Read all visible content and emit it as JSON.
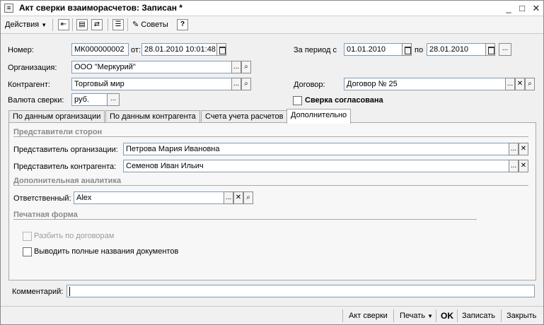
{
  "window": {
    "title": "Акт сверки взаиморасчетов: Записан *",
    "minimize_glyph": "_",
    "maximize_glyph": "□",
    "close_glyph": "✕"
  },
  "toolbar": {
    "actions_label": "Действия",
    "advice_label": "Советы",
    "help_glyph": "?"
  },
  "header": {
    "number_label": "Номер:",
    "number_value": "МК000000002",
    "from_label": "от:",
    "date_value": "28.01.2010 10:01:48",
    "period_label": "За период с",
    "period_from": "01.01.2010",
    "period_to_label": "по",
    "period_to": "28.01.2010",
    "organization_label": "Организация:",
    "organization_value": "ООО \"Меркурий\"",
    "counterparty_label": "Контрагент:",
    "counterparty_value": "Торговый мир",
    "contract_label": "Договор:",
    "contract_value": "Договор № 25",
    "currency_label": "Валюта сверки:",
    "currency_value": "руб.",
    "agreed_label": "Сверка согласована"
  },
  "tabs": [
    {
      "label": "По данным организации"
    },
    {
      "label": "По данным контрагента"
    },
    {
      "label": "Счета учета расчетов"
    },
    {
      "label": "Дополнительно"
    }
  ],
  "panel": {
    "reps_title": "Представители сторон",
    "org_rep_label": "Представитель организации:",
    "org_rep_value": "Петрова  Мария Ивановна",
    "cp_rep_label": "Представитель контрагента:",
    "cp_rep_value": "Семенов Иван Ильич",
    "analytics_title": "Дополнительная аналитика",
    "responsible_label": "Ответственный:",
    "responsible_value": "Alex",
    "print_title": "Печатная форма",
    "split_label": "Разбить по договорам",
    "full_names_label": "Выводить полные названия документов"
  },
  "comment": {
    "label": "Комментарий:",
    "value": ""
  },
  "footer": {
    "act_label": "Акт сверки",
    "print_label": "Печать",
    "ok_label": "OK",
    "save_label": "Записать",
    "close_label": "Закрыть"
  }
}
